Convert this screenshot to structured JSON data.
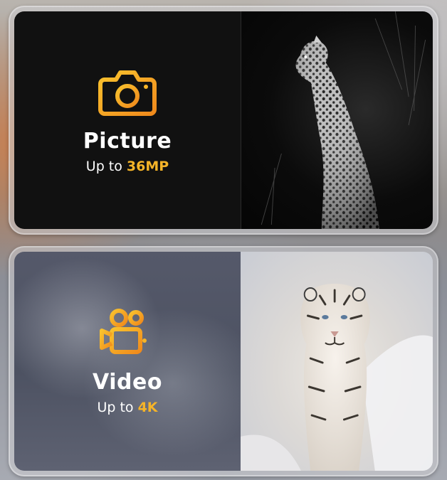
{
  "colors": {
    "accent": "#f5b428",
    "accent_deep": "#f08a1c",
    "title_text": "#ffffff"
  },
  "cards": [
    {
      "icon": "camera-icon",
      "title": "Picture",
      "subtitle_prefix": "Up to ",
      "subtitle_value": "36MP",
      "image": "leopard-night-photo"
    },
    {
      "icon": "video-camera-icon",
      "title": "Video",
      "subtitle_prefix": "Up to ",
      "subtitle_value": "4K",
      "image": "white-tiger-snow-photo"
    }
  ]
}
